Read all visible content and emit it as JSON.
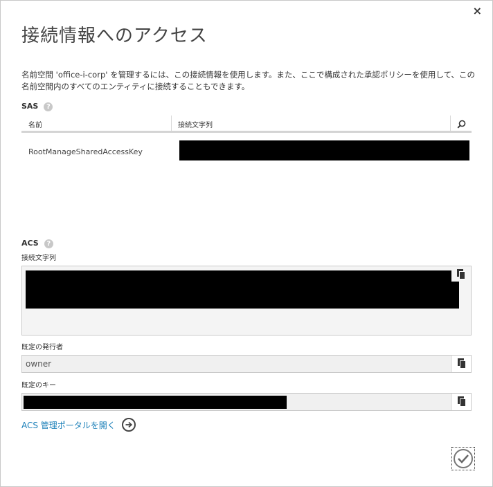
{
  "dialog": {
    "title": "接続情報へのアクセス",
    "close_symbol": "×",
    "description": "名前空間 'office-i-corp' を管理するには、この接続情報を使用します。また、ここで構成された承認ポリシーを使用して、この名前空間内のすべてのエンティティに接続することもできます。"
  },
  "sas": {
    "label": "SAS",
    "help": "?",
    "columns": [
      "名前",
      "接続文字列"
    ],
    "rows": [
      {
        "name": "RootManageSharedAccessKey",
        "connection_string": "[redacted]"
      }
    ]
  },
  "acs": {
    "label": "ACS",
    "help": "?",
    "connection_label": "接続文字列",
    "connection_value": "[redacted]",
    "issuer_label": "既定の発行者",
    "issuer_value": "owner",
    "key_label": "既定のキー",
    "key_value": "[redacted]",
    "portal_link": "ACS 管理ポータルを開く"
  },
  "icons": {
    "close": "close-icon",
    "help": "help-icon",
    "search": "search-icon",
    "copy": "copy-icon",
    "arrow": "arrow-right-circle-icon",
    "ok": "checkmark-icon"
  }
}
